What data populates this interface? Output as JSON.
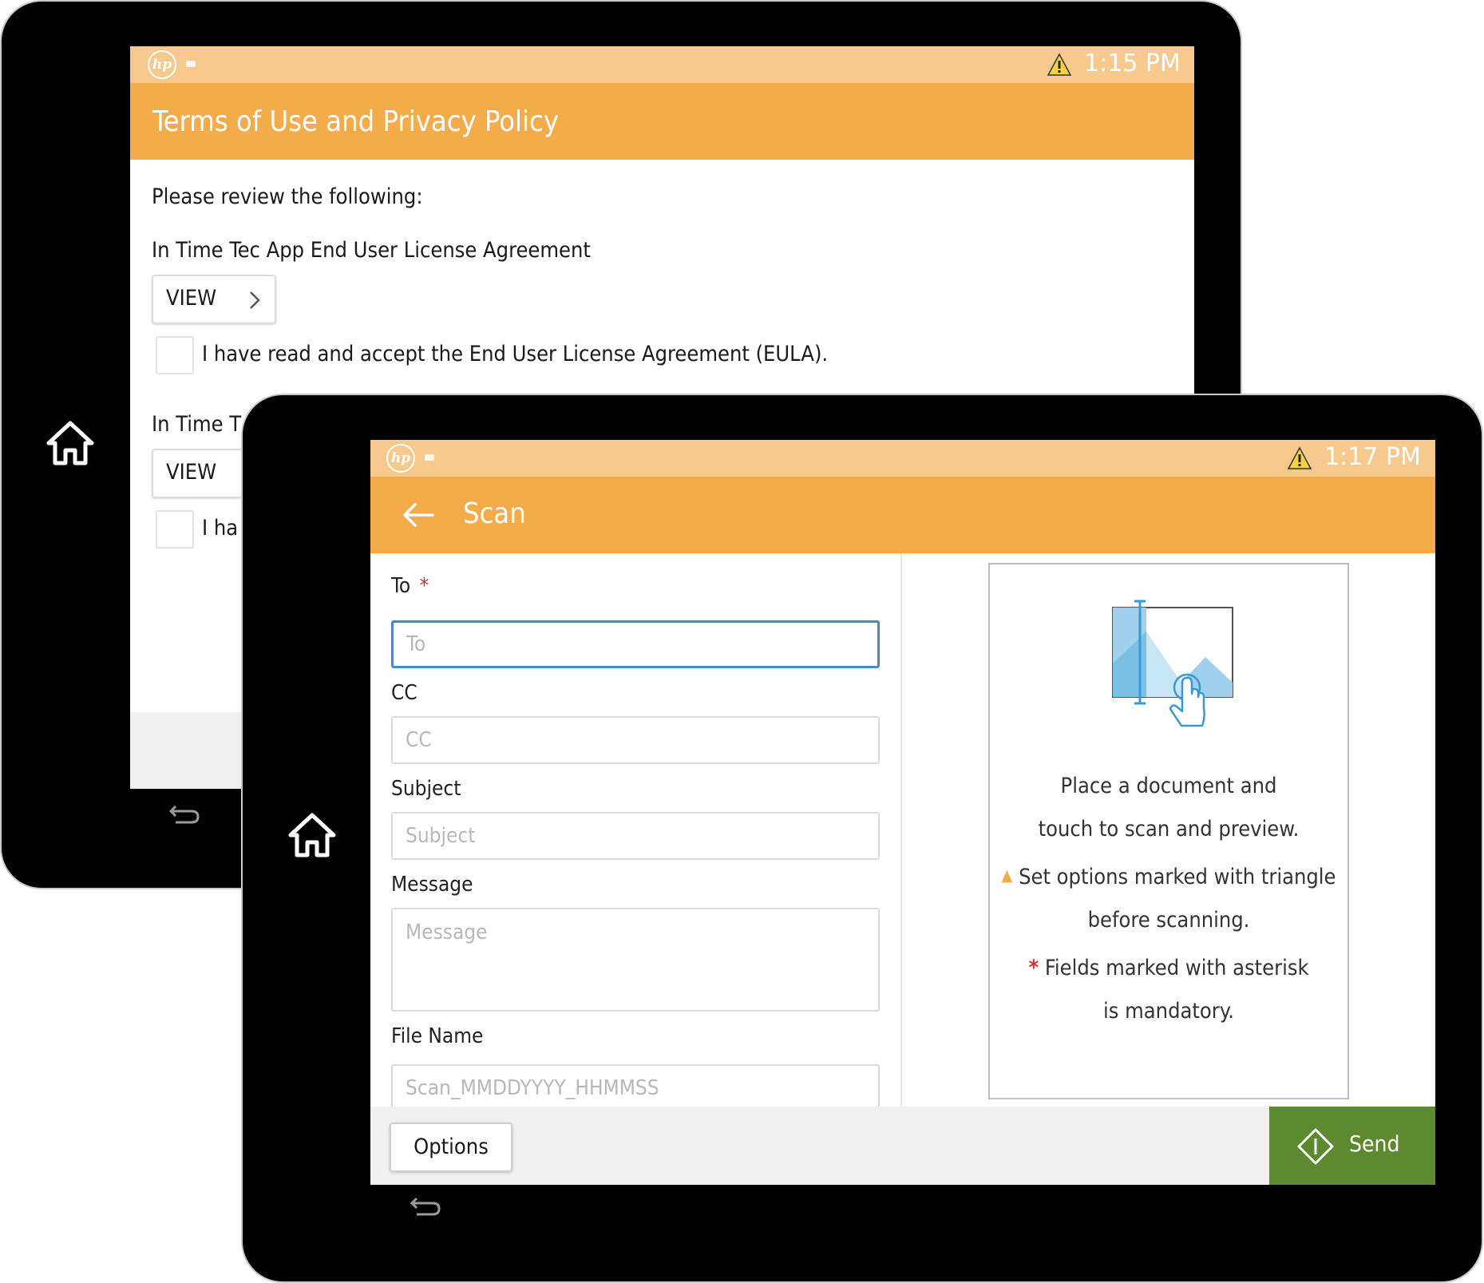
{
  "terms_screen": {
    "status_time": "1:15 PM",
    "title": "Terms of Use and Privacy Policy",
    "intro": "Please review the following:",
    "sections": [
      {
        "heading": "In Time Tec App End User License Agreement",
        "view_label": "VIEW",
        "accept_label": "I have read and accept the End User License Agreement (EULA)."
      },
      {
        "heading": "In Time T",
        "view_label": "VIEW",
        "accept_label": "I ha"
      }
    ]
  },
  "scan_screen": {
    "status_time": "1:17 PM",
    "title": "Scan",
    "form": {
      "to_label": "To",
      "required_mark": "*",
      "to_placeholder": "To",
      "cc_label": "CC",
      "cc_placeholder": "CC",
      "subject_label": "Subject",
      "subject_placeholder": "Subject",
      "message_label": "Message",
      "message_placeholder": "Message",
      "filename_label": "File Name",
      "filename_placeholder": "Scan_MMDDYYYY_HHMMSS"
    },
    "info": {
      "line1": "Place a document and",
      "line2": "touch to scan and preview.",
      "triangle_note_1": "Set options marked with triangle",
      "triangle_note_2": "before scanning.",
      "asterisk_mark": "*",
      "asterisk_note_1": "Fields marked with asterisk",
      "asterisk_note_2": "is mandatory."
    },
    "options_label": "Options",
    "send_label": "Send"
  },
  "colors": {
    "status_bar": "#f7c98d",
    "title_bar": "#f4ac4b",
    "send_button": "#5d8a2e",
    "required": "#d0342c",
    "focus_border": "#4f86c6"
  },
  "icons": [
    "hp-logo-icon",
    "warning-icon",
    "home-icon",
    "back-arrow-icon",
    "chevron-right-icon",
    "scan-preview-icon",
    "send-icon",
    "return-icon"
  ]
}
